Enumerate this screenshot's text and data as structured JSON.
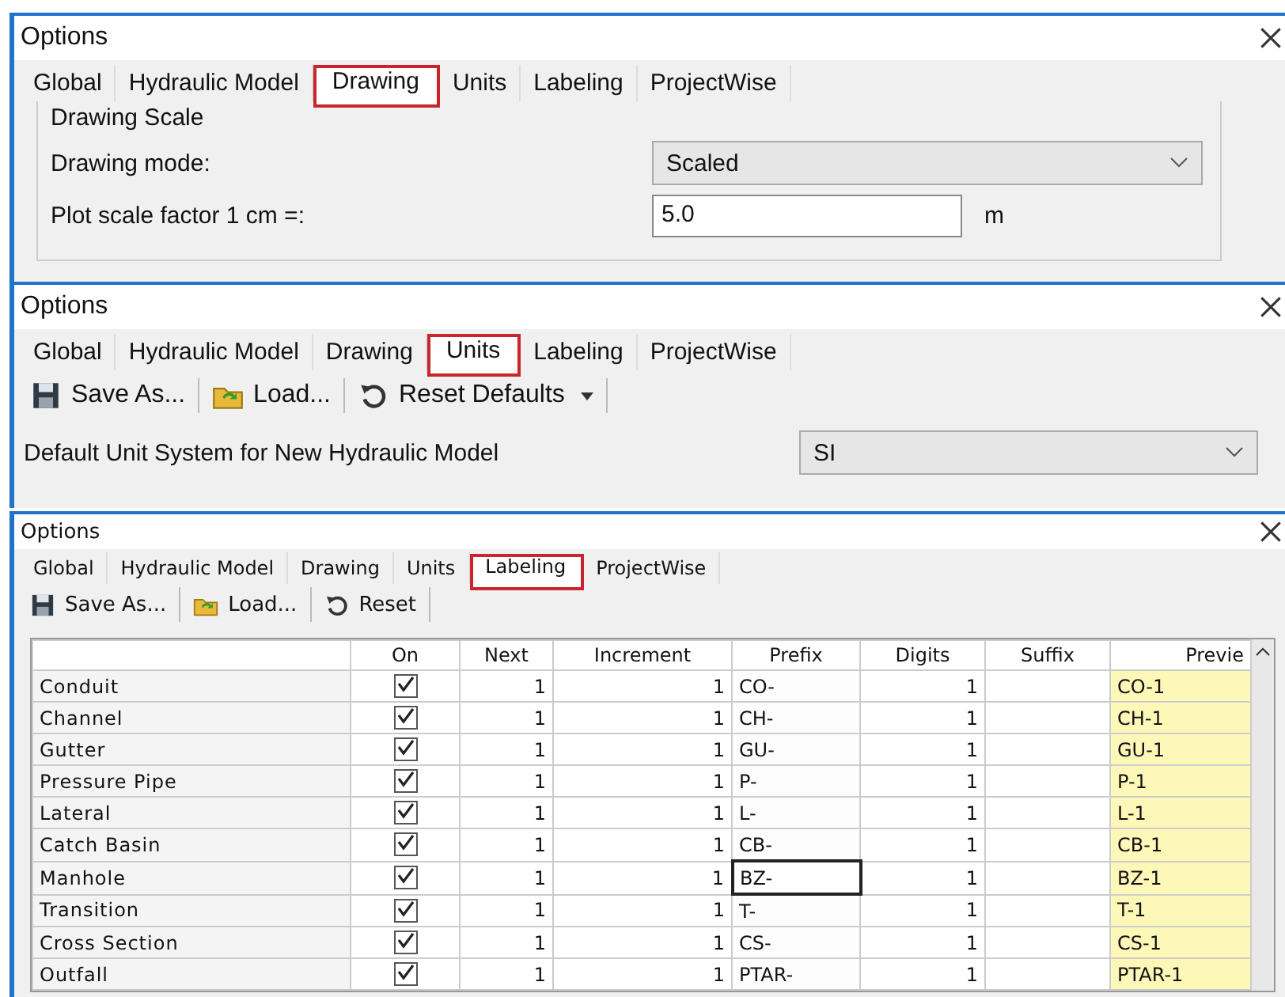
{
  "panels": [
    {
      "kind": "drawing",
      "title": "Options",
      "tabs": [
        {
          "label": "Global",
          "selected": false
        },
        {
          "label": "Hydraulic Model",
          "selected": false
        },
        {
          "label": "Drawing",
          "selected": true
        },
        {
          "label": "Units",
          "selected": false
        },
        {
          "label": "Labeling",
          "selected": false
        },
        {
          "label": "ProjectWise",
          "selected": false
        }
      ],
      "group_title": "Drawing Scale",
      "drawing_mode_label": "Drawing mode:",
      "drawing_mode_value": "Scaled",
      "scale_label": "Plot scale factor  1 cm =:",
      "scale_value": "5.0",
      "scale_unit": "m"
    },
    {
      "kind": "units",
      "title": "Options",
      "tabs": [
        {
          "label": "Global",
          "selected": false
        },
        {
          "label": "Hydraulic Model",
          "selected": false
        },
        {
          "label": "Drawing",
          "selected": false
        },
        {
          "label": "Units",
          "selected": true
        },
        {
          "label": "Labeling",
          "selected": false
        },
        {
          "label": "ProjectWise",
          "selected": false
        }
      ],
      "toolbar": [
        "Save As...",
        "Load...",
        "Reset Defaults"
      ],
      "unit_label": "Default Unit System for New Hydraulic Model",
      "unit_value": "SI"
    },
    {
      "kind": "labeling",
      "title": "Options",
      "tabs": [
        {
          "label": "Global",
          "selected": false
        },
        {
          "label": "Hydraulic Model",
          "selected": false
        },
        {
          "label": "Drawing",
          "selected": false
        },
        {
          "label": "Units",
          "selected": false
        },
        {
          "label": "Labeling",
          "selected": true
        },
        {
          "label": "ProjectWise",
          "selected": false
        }
      ],
      "toolbar": [
        "Save As...",
        "Load...",
        "Reset"
      ],
      "columns": [
        "On",
        "Next",
        "Increment",
        "Prefix",
        "Digits",
        "Suffix",
        "Previe"
      ],
      "rows": [
        {
          "name": "Conduit",
          "on": true,
          "next": "1",
          "increment": "1",
          "prefix": "CO-",
          "digits": "1",
          "preview": "CO-1",
          "focused": false
        },
        {
          "name": "Channel",
          "on": true,
          "next": "1",
          "increment": "1",
          "prefix": "CH-",
          "digits": "1",
          "preview": "CH-1",
          "focused": false
        },
        {
          "name": "Gutter",
          "on": true,
          "next": "1",
          "increment": "1",
          "prefix": "GU-",
          "digits": "1",
          "preview": "GU-1",
          "focused": false
        },
        {
          "name": "Pressure Pipe",
          "on": true,
          "next": "1",
          "increment": "1",
          "prefix": "P-",
          "digits": "1",
          "preview": "P-1",
          "focused": false
        },
        {
          "name": "Lateral",
          "on": true,
          "next": "1",
          "increment": "1",
          "prefix": "L-",
          "digits": "1",
          "preview": "L-1",
          "focused": false
        },
        {
          "name": "Catch Basin",
          "on": true,
          "next": "1",
          "increment": "1",
          "prefix": "CB-",
          "digits": "1",
          "preview": "CB-1",
          "focused": false
        },
        {
          "name": "Manhole",
          "on": true,
          "next": "1",
          "increment": "1",
          "prefix": "BZ-",
          "digits": "1",
          "preview": "BZ-1",
          "focused": true
        },
        {
          "name": "Transition",
          "on": true,
          "next": "1",
          "increment": "1",
          "prefix": "T-",
          "digits": "1",
          "preview": "T-1",
          "focused": false
        },
        {
          "name": "Cross Section",
          "on": true,
          "next": "1",
          "increment": "1",
          "prefix": "CS-",
          "digits": "1",
          "preview": "CS-1",
          "focused": false
        },
        {
          "name": "Outfall",
          "on": true,
          "next": "1",
          "increment": "1",
          "prefix": "PTAR-",
          "digits": "1",
          "preview": "PTAR-1",
          "focused": false
        }
      ]
    }
  ]
}
